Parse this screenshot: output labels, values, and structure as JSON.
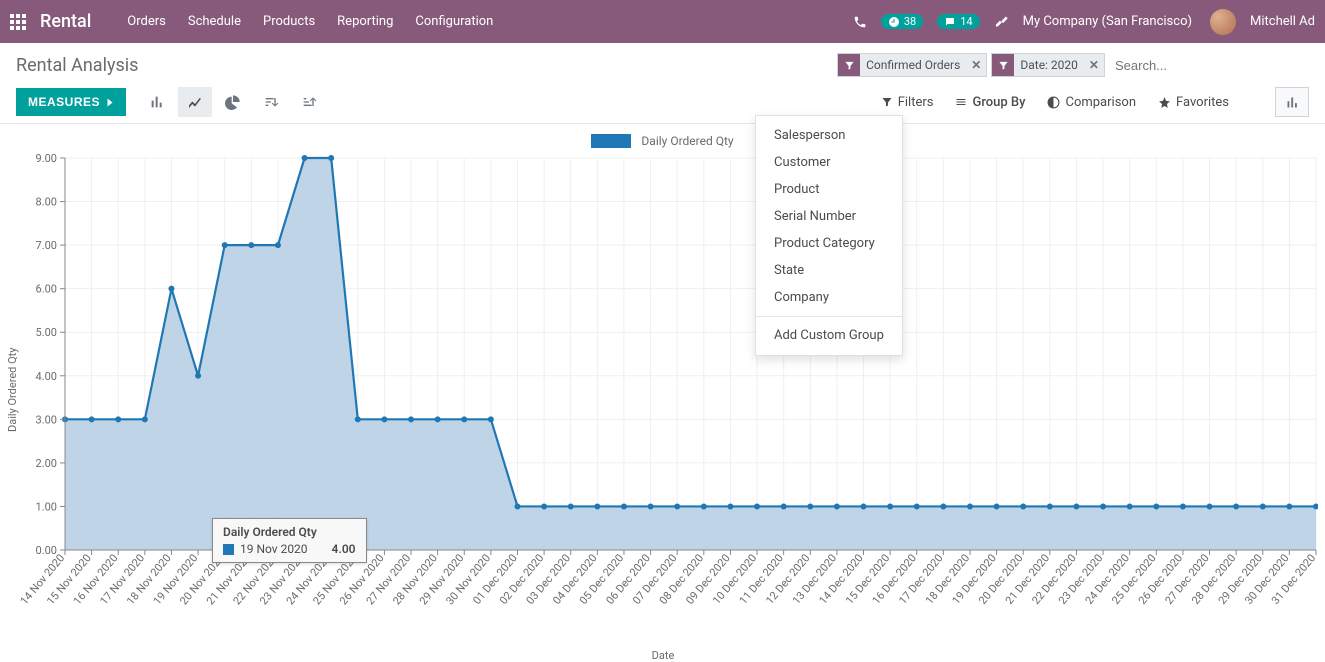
{
  "topnav": {
    "brand": "Rental",
    "menu": [
      "Orders",
      "Schedule",
      "Products",
      "Reporting",
      "Configuration"
    ],
    "badge_clock": "38",
    "badge_chat": "14",
    "company": "My Company (San Francisco)",
    "user": "Mitchell Ad"
  },
  "page": {
    "title": "Rental Analysis"
  },
  "search": {
    "facets": [
      {
        "label": "Confirmed Orders"
      },
      {
        "label": "Date: 2020"
      }
    ],
    "placeholder": "Search..."
  },
  "measures_btn": "MEASURES",
  "options": {
    "filters": "Filters",
    "groupby": "Group By",
    "comparison": "Comparison",
    "favorites": "Favorites"
  },
  "groupby_menu": {
    "items": [
      "Salesperson",
      "Customer",
      "Product",
      "Serial Number",
      "Product Category",
      "State",
      "Company"
    ],
    "add_custom": "Add Custom Group"
  },
  "legend": "Daily Ordered Qty",
  "ylabel": "Daily Ordered Qty",
  "xlabel": "Date",
  "tooltip": {
    "title": "Daily Ordered Qty",
    "label": "19 Nov 2020",
    "value": "4.00"
  },
  "chart_data": {
    "type": "area",
    "title": "",
    "xlabel": "Date",
    "ylabel": "Daily Ordered Qty",
    "ylim": [
      0,
      9
    ],
    "yticks": [
      0.0,
      1.0,
      2.0,
      3.0,
      4.0,
      5.0,
      6.0,
      7.0,
      8.0,
      9.0
    ],
    "categories": [
      "14 Nov 2020",
      "15 Nov 2020",
      "16 Nov 2020",
      "17 Nov 2020",
      "18 Nov 2020",
      "19 Nov 2020",
      "20 Nov 2020",
      "21 Nov 2020",
      "22 Nov 2020",
      "23 Nov 2020",
      "24 Nov 2020",
      "25 Nov 2020",
      "26 Nov 2020",
      "27 Nov 2020",
      "28 Nov 2020",
      "29 Nov 2020",
      "30 Nov 2020",
      "01 Dec 2020",
      "02 Dec 2020",
      "03 Dec 2020",
      "04 Dec 2020",
      "05 Dec 2020",
      "06 Dec 2020",
      "07 Dec 2020",
      "08 Dec 2020",
      "09 Dec 2020",
      "10 Dec 2020",
      "11 Dec 2020",
      "12 Dec 2020",
      "13 Dec 2020",
      "14 Dec 2020",
      "15 Dec 2020",
      "16 Dec 2020",
      "17 Dec 2020",
      "18 Dec 2020",
      "19 Dec 2020",
      "20 Dec 2020",
      "21 Dec 2020",
      "22 Dec 2020",
      "23 Dec 2020",
      "24 Dec 2020",
      "25 Dec 2020",
      "26 Dec 2020",
      "27 Dec 2020",
      "28 Dec 2020",
      "29 Dec 2020",
      "30 Dec 2020",
      "31 Dec 2020"
    ],
    "series": [
      {
        "name": "Daily Ordered Qty",
        "values": [
          3,
          3,
          3,
          3,
          6,
          4,
          7,
          7,
          7,
          9,
          9,
          3,
          3,
          3,
          3,
          3,
          3,
          1,
          1,
          1,
          1,
          1,
          1,
          1,
          1,
          1,
          1,
          1,
          1,
          1,
          1,
          1,
          1,
          1,
          1,
          1,
          1,
          1,
          1,
          1,
          1,
          1,
          1,
          1,
          1,
          1,
          1,
          1
        ]
      }
    ]
  },
  "colors": {
    "primary": "#875a7b",
    "teal": "#00a09d",
    "series": "#1f77b4",
    "area": "#b4cee3"
  }
}
